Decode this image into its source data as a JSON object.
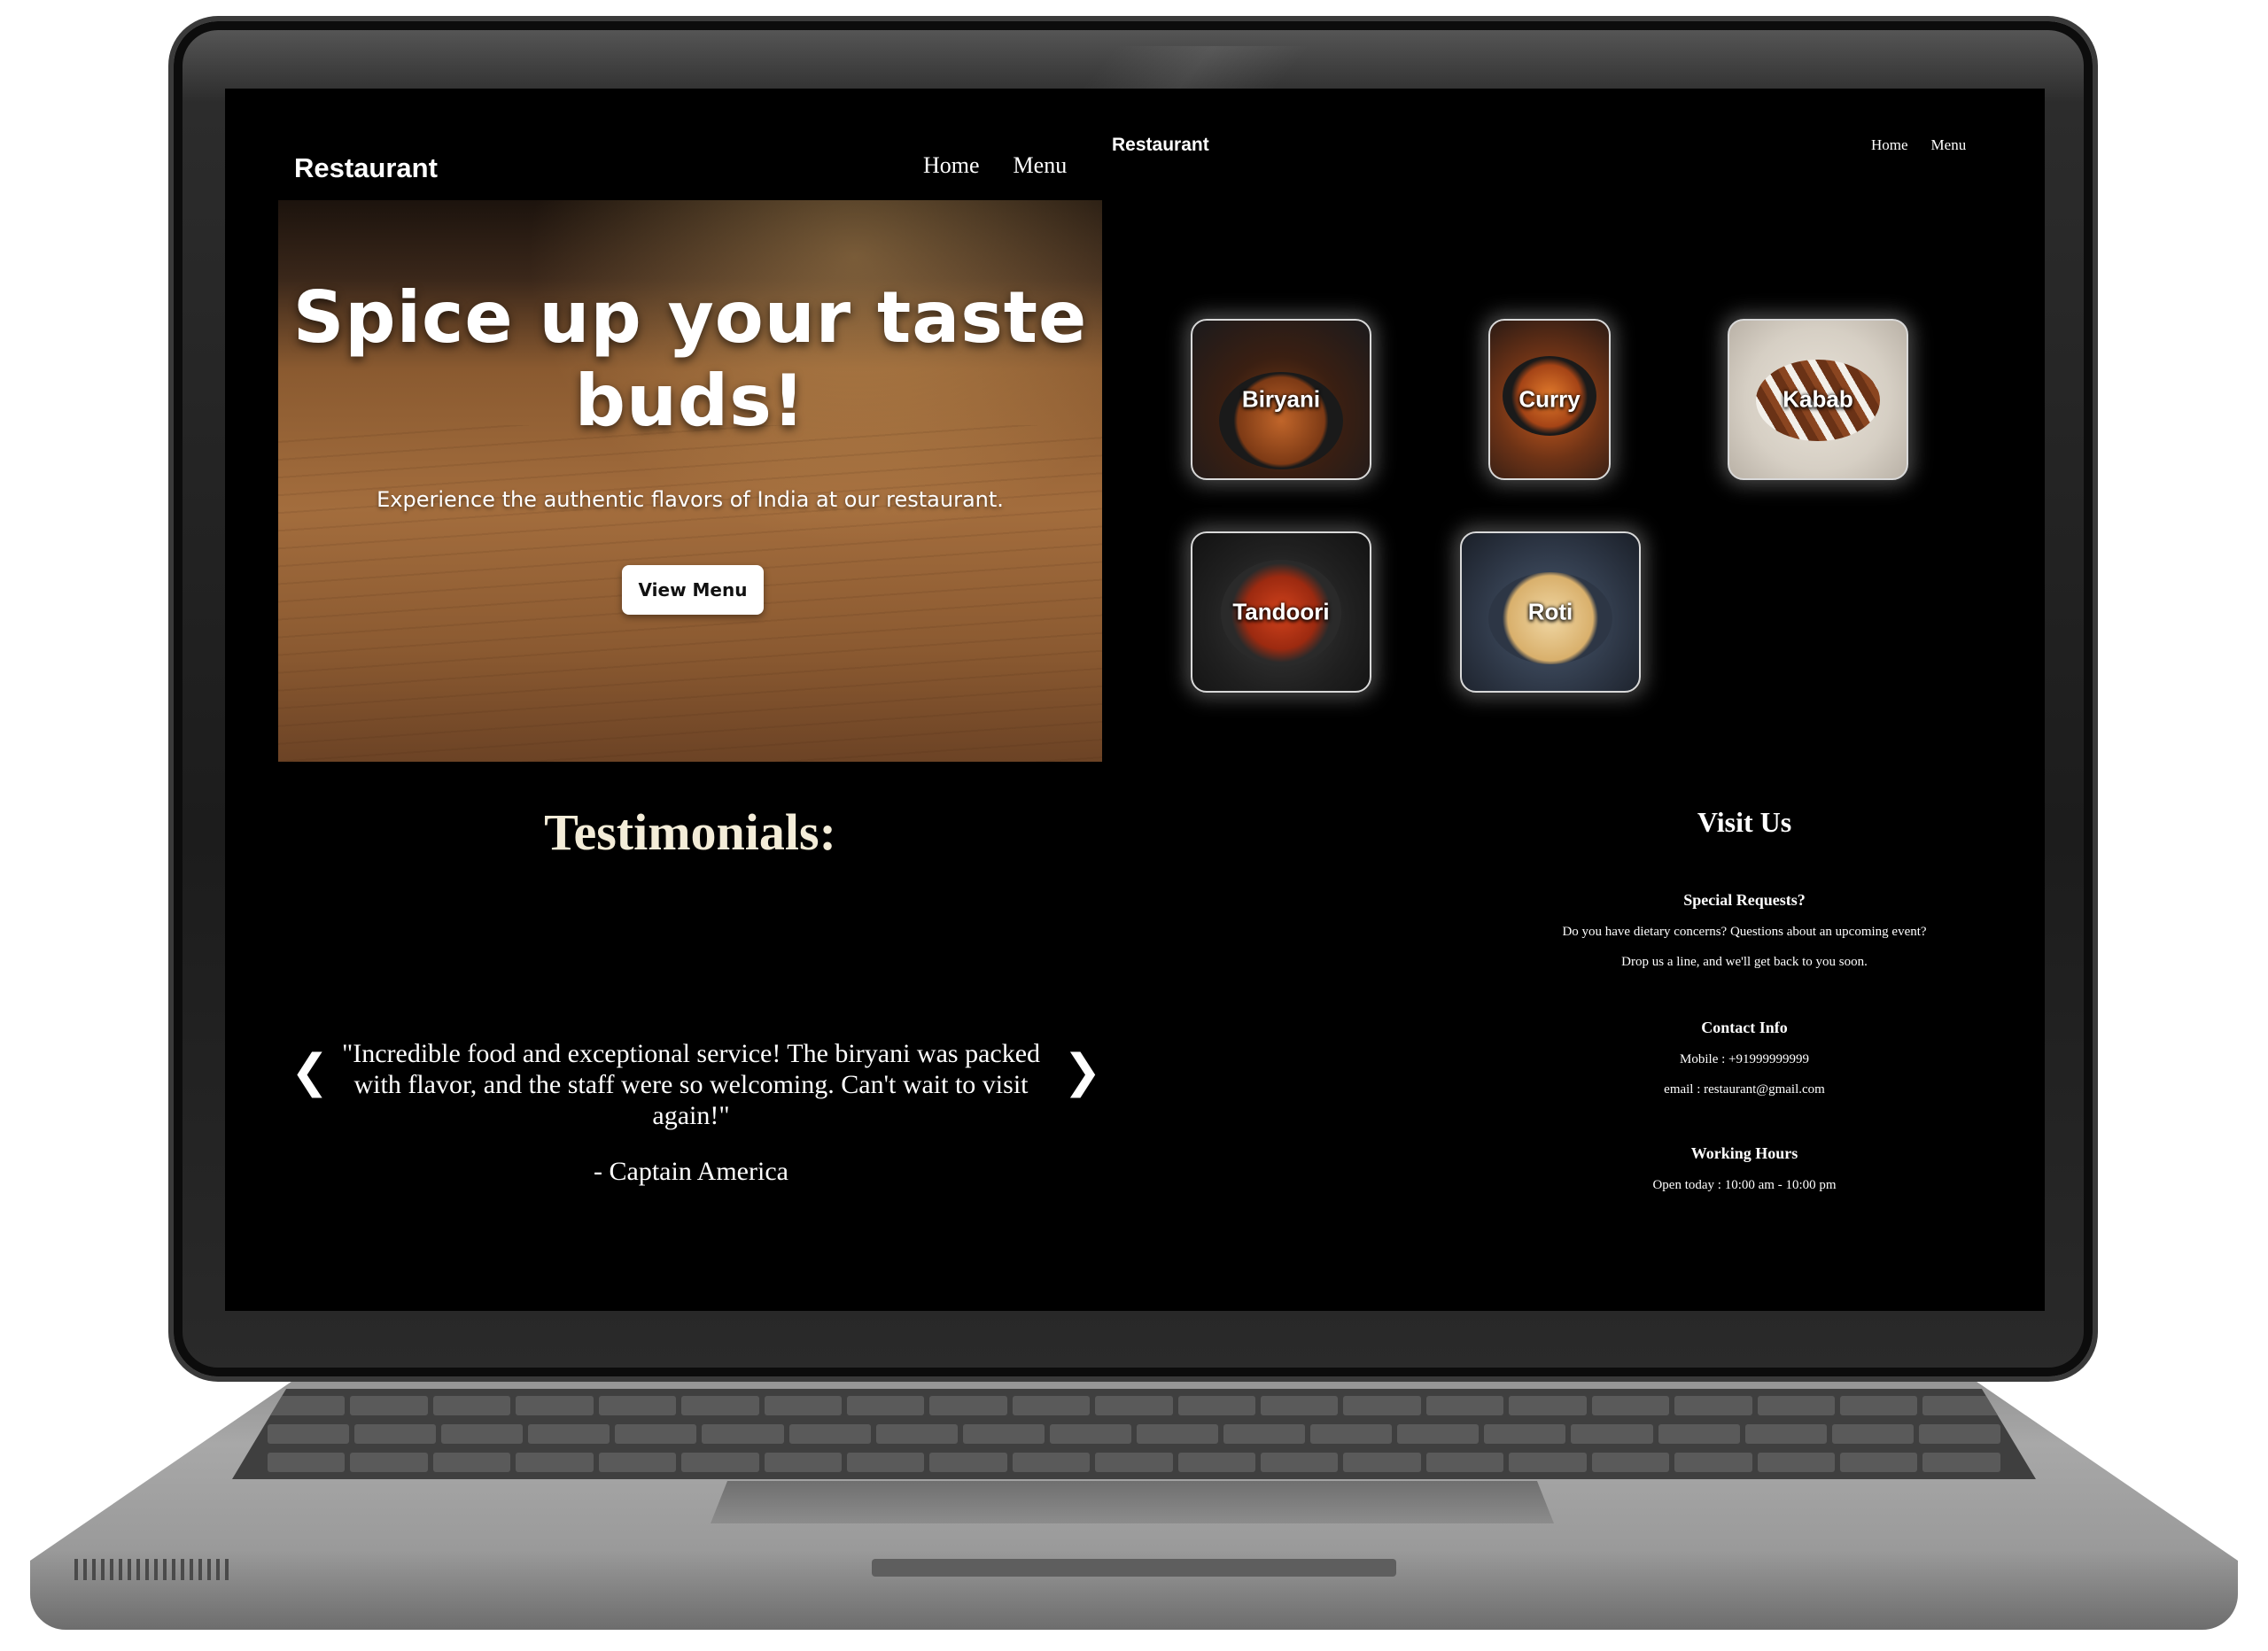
{
  "left_page": {
    "brand": "Restaurant",
    "nav": [
      "Home",
      "Menu"
    ],
    "hero": {
      "title": "Spice up your taste buds!",
      "subtitle": "Experience the authentic flavors of India at our restaurant.",
      "button": "View Menu"
    },
    "testimonials": {
      "title": "Testimonials:",
      "quote": "\"Incredible food and exceptional service! The biryani was packed with flavor, and the staff were so welcoming. Can't wait to visit again!\"",
      "author": "- Captain America",
      "prev": "❮",
      "next": "❯"
    }
  },
  "right_page": {
    "brand": "Restaurant",
    "nav": [
      "Home",
      "Menu"
    ],
    "menu_items": [
      "Biryani",
      "Curry",
      "Kabab",
      "Tandoori",
      "Roti"
    ],
    "visit": {
      "title": "Visit Us",
      "special_heading": "Special Requests?",
      "special_line1": "Do you have dietary concerns? Questions about an upcoming event?",
      "special_line2": "Drop us a line, and we'll get back to you soon.",
      "contact_heading": "Contact Info",
      "mobile": "Mobile : +91999999999",
      "email": "email : restaurant@gmail.com",
      "hours_heading": "Working Hours",
      "hours": "Open today : 10:00 am - 10:00 pm"
    }
  }
}
